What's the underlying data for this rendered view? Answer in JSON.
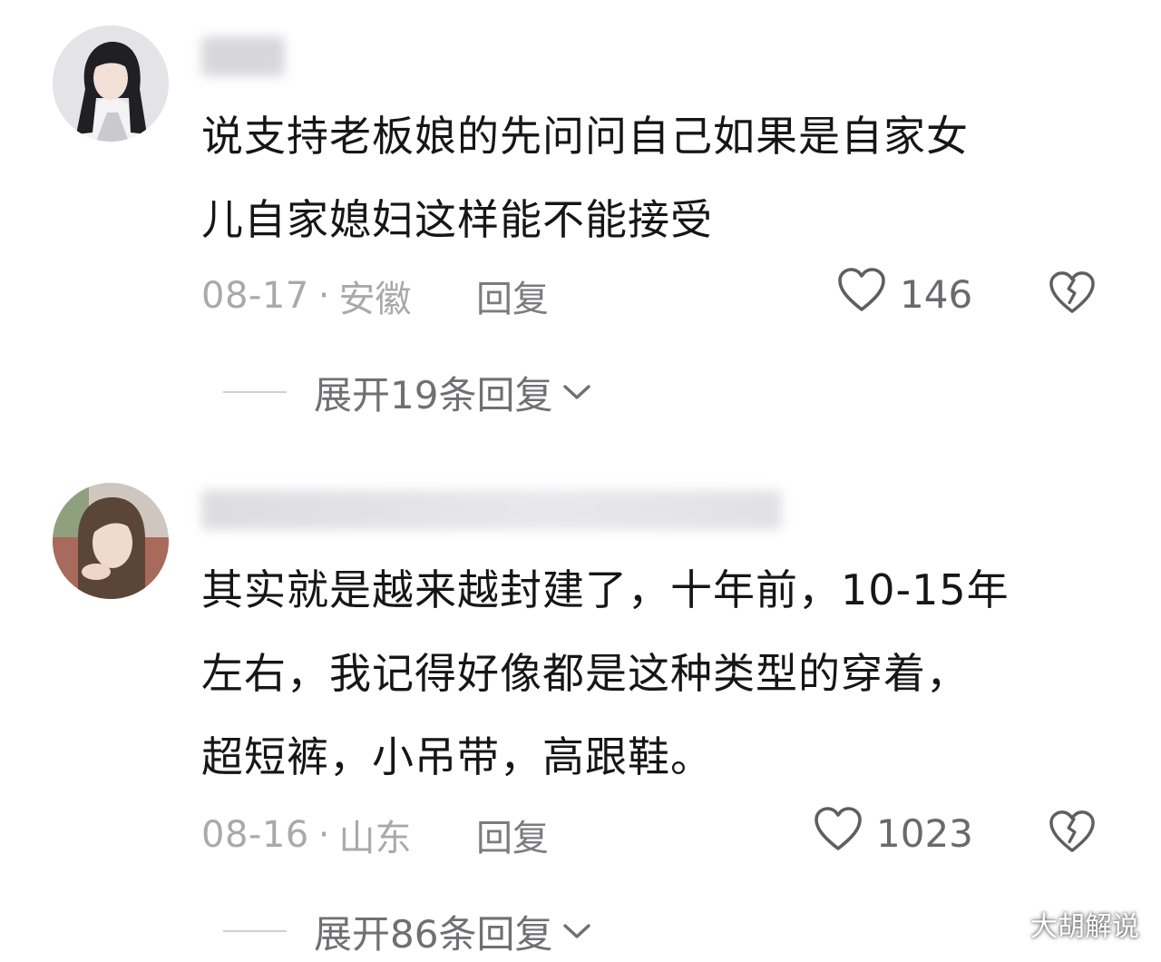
{
  "comments": [
    {
      "username": "",
      "text_lines": [
        "说支持老板娘的先问问自己如果是自家女",
        "儿自家媳妇这样能不能接受"
      ],
      "date": "08-17",
      "separator": "·",
      "location": "安徽",
      "reply_label": "回复",
      "like_count": "146",
      "expand_label": "展开19条回复"
    },
    {
      "username": "",
      "text_lines": [
        "其实就是越来越封建了，十年前，10-15年",
        "左右，我记得好像都是这种类型的穿着，",
        "超短裤，小吊带，高跟鞋。"
      ],
      "date": "08-16",
      "separator": "·",
      "location": "山东",
      "reply_label": "回复",
      "like_count": "1023",
      "expand_label": "展开86条回复"
    }
  ],
  "icons": {
    "like": "heart-outline-icon",
    "dislike": "broken-heart-icon",
    "expand": "chevron-down-icon",
    "watermark": "paw-icon"
  },
  "watermark": {
    "text": "大胡解说"
  },
  "colors": {
    "text": "#161616",
    "meta": "#a9a9ad",
    "reply": "#7b7b80",
    "icon": "#6a6a6e"
  }
}
